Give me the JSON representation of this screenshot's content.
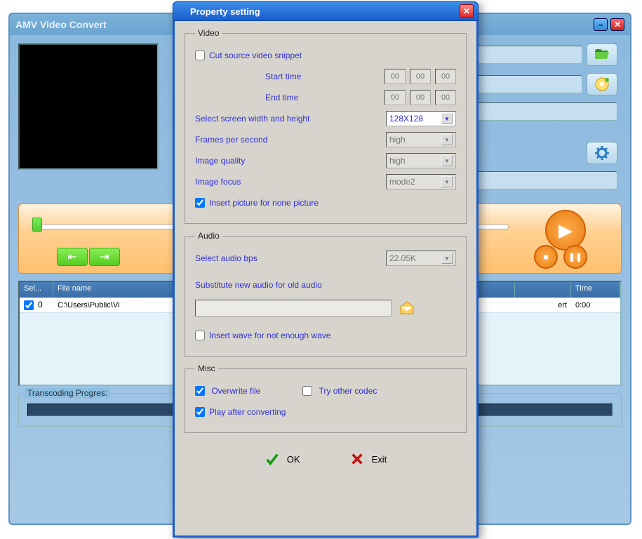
{
  "main": {
    "title": "AMV Video Convert",
    "table": {
      "headers": {
        "sel": "Sel...",
        "file": "File name",
        "status": "",
        "time": "Time"
      },
      "rows": [
        {
          "checked": true,
          "index": "0",
          "file": "C:\\Users\\Public\\Vi",
          "status": "ert",
          "time": "0:00"
        }
      ]
    },
    "progress_label": "Transcoding Progres:"
  },
  "dialog": {
    "title": "Property setting",
    "video": {
      "legend": "Video",
      "cut_label": "Cut source video snippet",
      "start_time": "Start time",
      "end_time": "End time",
      "time_vals": {
        "h": "00",
        "m": "00",
        "s": "00"
      },
      "screen_label": "Select screen width and height",
      "screen_value": "128X128",
      "fps_label": "Frames per second",
      "fps_value": "high",
      "quality_label": "Image quality",
      "quality_value": "high",
      "focus_label": "Image focus",
      "focus_value": "mode2",
      "insert_pic": "Insert picture for none picture"
    },
    "audio": {
      "legend": "Audio",
      "bps_label": "Select audio bps",
      "bps_value": "22.05K",
      "substitute": "Substitute new audio for old audio",
      "insert_wave": "Insert wave for not enough wave"
    },
    "misc": {
      "legend": "Misc",
      "overwrite": "Overwrite file",
      "try_codec": "Try other codec",
      "play_after": "Play after converting"
    },
    "buttons": {
      "ok": "OK",
      "exit": "Exit"
    }
  }
}
